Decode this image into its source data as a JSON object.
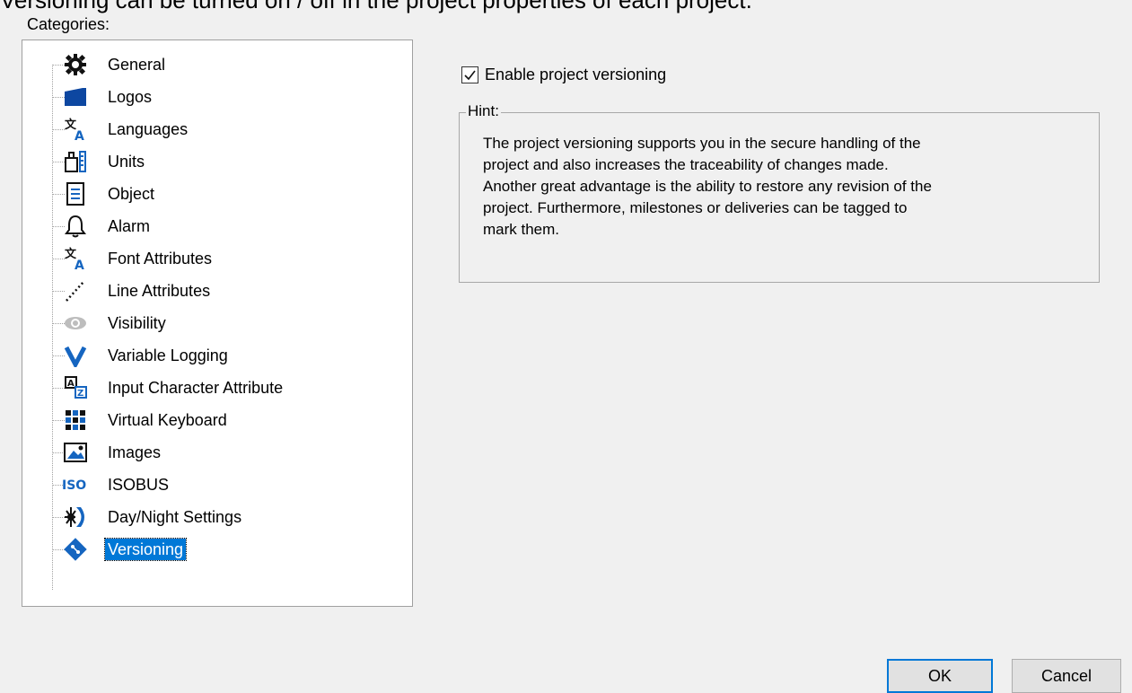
{
  "top_caption": "Versioning can be turned on / off in the project properties of each project.",
  "categories_label": "Categories:",
  "tree": {
    "items": [
      {
        "label": "General",
        "icon": "gear-icon"
      },
      {
        "label": "Logos",
        "icon": "folder-icon"
      },
      {
        "label": "Languages",
        "icon": "language-icon"
      },
      {
        "label": "Units",
        "icon": "ruler-icon"
      },
      {
        "label": "Object",
        "icon": "document-icon"
      },
      {
        "label": "Alarm",
        "icon": "bell-icon"
      },
      {
        "label": "Font Attributes",
        "icon": "font-icon"
      },
      {
        "label": "Line Attributes",
        "icon": "dotted-line-icon"
      },
      {
        "label": "Visibility",
        "icon": "eye-icon"
      },
      {
        "label": "Variable Logging",
        "icon": "v-icon"
      },
      {
        "label": "Input Character Attribute",
        "icon": "input-character-icon"
      },
      {
        "label": "Virtual Keyboard",
        "icon": "keyboard-grid-icon"
      },
      {
        "label": "Images",
        "icon": "image-icon"
      },
      {
        "label": "ISOBUS",
        "icon": "iso-icon"
      },
      {
        "label": "Day/Night Settings",
        "icon": "day-night-icon"
      },
      {
        "label": "Versioning",
        "icon": "git-icon",
        "selected": true
      }
    ]
  },
  "versioning": {
    "enable_label": "Enable project versioning",
    "enabled": true,
    "hint_title": "Hint:",
    "hint_lines": [
      "The project versioning supports you in the secure handling of the",
      "project and also increases the traceability of changes made.",
      "Another great advantage is the ability to restore any revision of the",
      "project. Furthermore, milestones or deliveries can be tagged to",
      "mark them."
    ]
  },
  "buttons": {
    "ok": "OK",
    "cancel": "Cancel"
  },
  "colors": {
    "accent": "#0078d7",
    "icon_blue": "#1565c0"
  }
}
